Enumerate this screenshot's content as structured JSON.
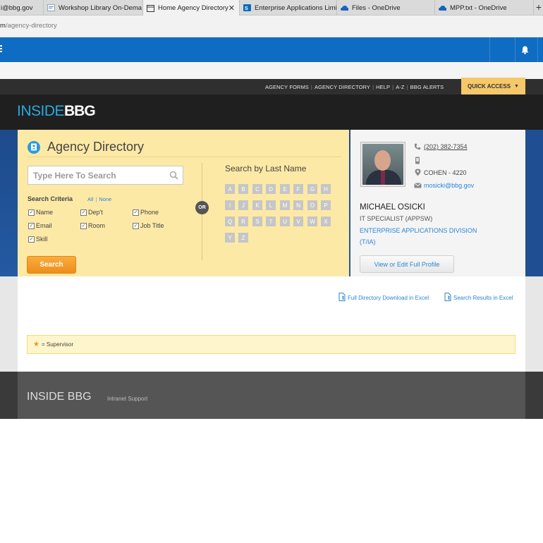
{
  "browser": {
    "tabs": [
      {
        "label": "i@bbg.gov",
        "icon": "mail-icon"
      },
      {
        "label": "Workshop Library On-Dema",
        "icon": "page-icon"
      },
      {
        "label": "Home Agency Directory",
        "icon": "window-icon",
        "active": true
      },
      {
        "label": "Enterprise Applications Limi",
        "icon": "sharepoint-icon"
      },
      {
        "label": "Files - OneDrive",
        "icon": "cloud-icon"
      },
      {
        "label": "MPP.txt - OneDrive",
        "icon": "cloud-icon"
      }
    ],
    "new_tab": "+",
    "close_glyph": "✕",
    "address_prefix": "m",
    "address_path": "/agency-directory"
  },
  "topnav": {
    "links": [
      "AGENCY FORMS",
      "AGENCY DIRECTORY",
      "HELP",
      "A-Z",
      "BBG ALERTS"
    ],
    "quick_access": "QUICK ACCESS"
  },
  "logo": {
    "part1": "INSIDE",
    "part2": "BBG"
  },
  "directory": {
    "title": "Agency Directory",
    "search_placeholder": "Type Here To Search",
    "criteria_label": "Search Criteria",
    "all_label": "All",
    "none_label": "None",
    "criteria": [
      {
        "label": "Name",
        "checked": true
      },
      {
        "label": "Dep't",
        "checked": true
      },
      {
        "label": "Phone",
        "checked": true
      },
      {
        "label": "Email",
        "checked": true
      },
      {
        "label": "Room",
        "checked": true
      },
      {
        "label": "Job Title",
        "checked": true
      },
      {
        "label": "Skill",
        "checked": true
      }
    ],
    "search_button": "Search",
    "or_label": "OR",
    "lastname_title": "Search by Last Name",
    "letters": [
      "A",
      "B",
      "C",
      "D",
      "E",
      "F",
      "G",
      "H",
      "I",
      "J",
      "K",
      "L",
      "M",
      "N",
      "O",
      "P",
      "Q",
      "R",
      "S",
      "T",
      "U",
      "V",
      "W",
      "X",
      "Y",
      "Z"
    ]
  },
  "profile": {
    "phone": "(202) 382-7354",
    "location": "COHEN - 4220",
    "email": "mosicki@bbg.gov",
    "name": "MICHAEL OSICKI",
    "title": "IT SPECIALIST (APPSW)",
    "division_line1": "ENTERPRISE APPLICATIONS DIVISION",
    "division_line2": "(T/IA)",
    "edit_button": "View or Edit Full Profile"
  },
  "downloads": {
    "full_directory": "Full Directory Download in Excel",
    "search_results": "Search Results in Excel"
  },
  "legend": {
    "text": "= Supervisor"
  },
  "footer": {
    "title": "INSIDE BBG",
    "support": "Intranet Support"
  },
  "colors": {
    "accent_blue": "#0f6cc3",
    "link_blue": "#2a86d5",
    "orange": "#ee8d1b",
    "panel_yellow": "#fde9a6"
  }
}
